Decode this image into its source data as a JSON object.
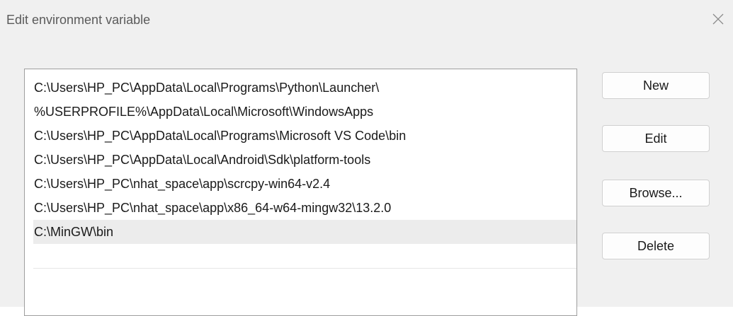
{
  "dialog": {
    "title": "Edit environment variable",
    "close_icon": "close-icon"
  },
  "variable_list": {
    "items": [
      {
        "value": "C:\\Users\\HP_PC\\AppData\\Local\\Programs\\Python\\Launcher\\",
        "selected": false
      },
      {
        "value": "%USERPROFILE%\\AppData\\Local\\Microsoft\\WindowsApps",
        "selected": false
      },
      {
        "value": "C:\\Users\\HP_PC\\AppData\\Local\\Programs\\Microsoft VS Code\\bin",
        "selected": false
      },
      {
        "value": "C:\\Users\\HP_PC\\AppData\\Local\\Android\\Sdk\\platform-tools",
        "selected": false
      },
      {
        "value": "C:\\Users\\HP_PC\\nhat_space\\app\\scrcpy-win64-v2.4",
        "selected": false
      },
      {
        "value": "C:\\Users\\HP_PC\\nhat_space\\app\\x86_64-w64-mingw32\\13.2.0",
        "selected": false
      },
      {
        "value": "C:\\MinGW\\bin",
        "selected": true
      }
    ]
  },
  "buttons": {
    "new_label": "New",
    "edit_label": "Edit",
    "browse_label": "Browse...",
    "delete_label": "Delete"
  },
  "colors": {
    "selected_row": "#ececec",
    "dialog_background": "#f0f0f0",
    "list_border": "#9e9e9e"
  }
}
